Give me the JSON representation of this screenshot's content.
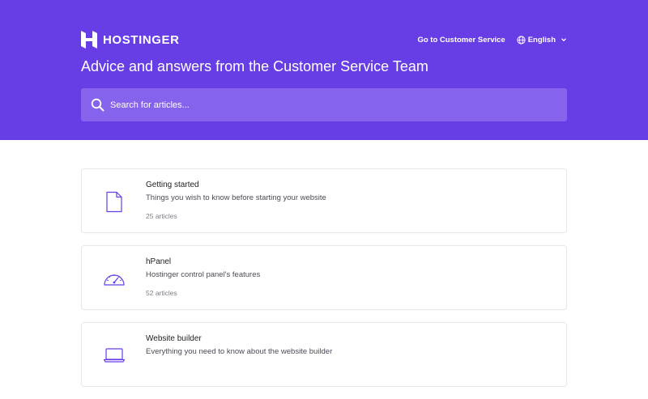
{
  "header": {
    "brand": "HOSTINGER",
    "nav_link": "Go to Customer Service",
    "language": "English",
    "headline": "Advice and answers from the Customer Service Team"
  },
  "search": {
    "placeholder": "Search for articles..."
  },
  "collections": [
    {
      "icon": "document-icon",
      "title": "Getting started",
      "description": "Things you wish to know before starting your website",
      "count": "25 articles"
    },
    {
      "icon": "speedometer-icon",
      "title": "hPanel",
      "description": "Hostinger control panel's features",
      "count": "52 articles"
    },
    {
      "icon": "laptop-icon",
      "title": "Website builder",
      "description": "Everything you need to know about the website builder",
      "count": ""
    }
  ],
  "colors": {
    "brand": "#673de6",
    "search_bg": "#8563ec",
    "icon_stroke": "#673de6"
  }
}
